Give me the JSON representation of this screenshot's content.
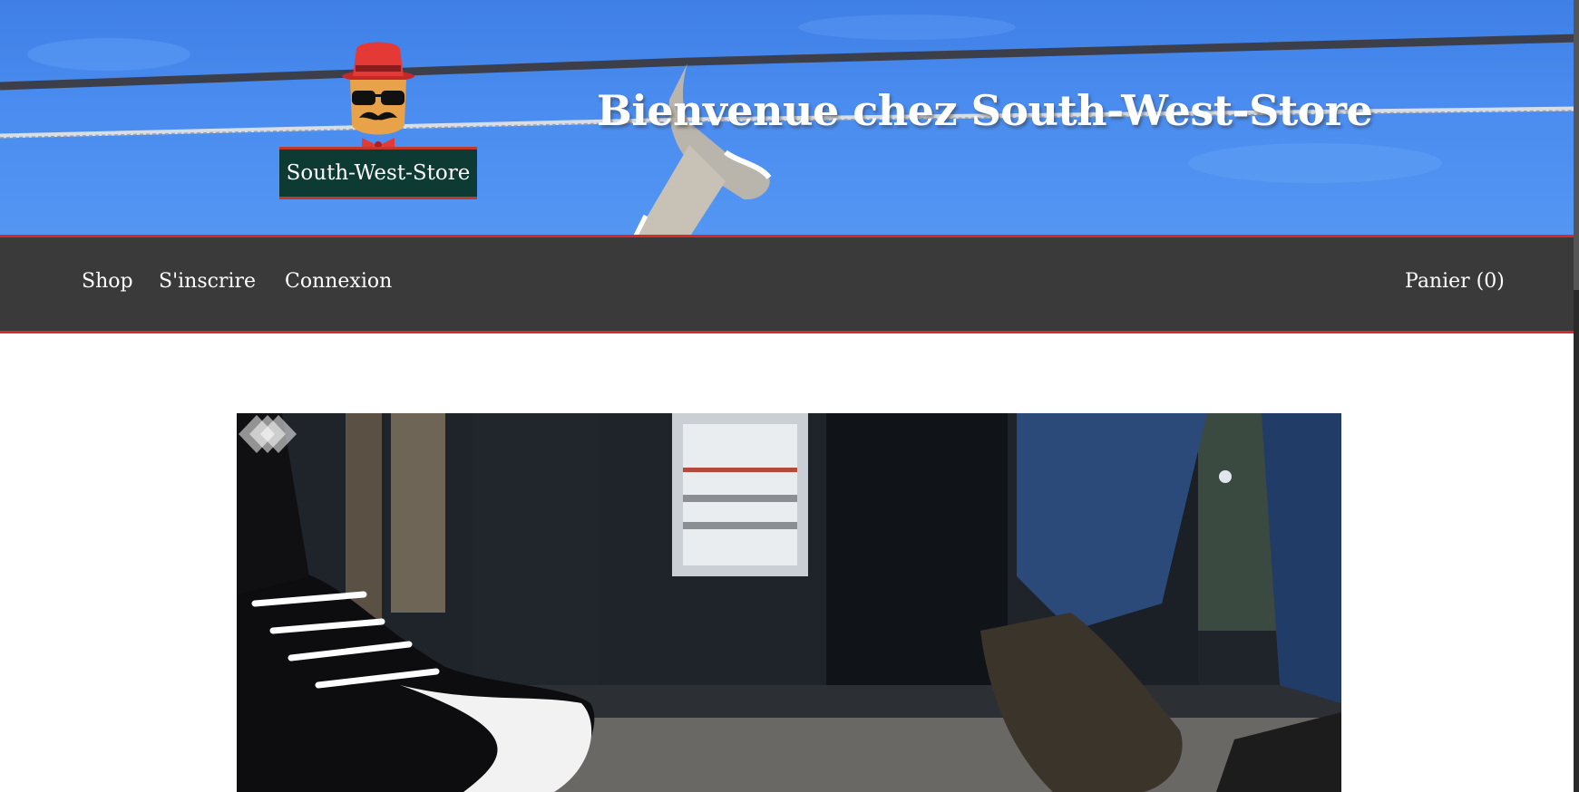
{
  "header": {
    "welcome_text": "Bienvenue chez South-West-Store",
    "logo_text": "South-West-Store",
    "logo_icon": "mustache-man-icon"
  },
  "nav": {
    "items": [
      {
        "label": "Shop"
      },
      {
        "label": "S'inscrire"
      },
      {
        "label": "Connexion"
      }
    ],
    "cart_label": "Panier (0)"
  },
  "hero": {
    "badge_icon": "diamonds-logo-icon"
  },
  "colors": {
    "banner_sky": "#4a8cf0",
    "nav_bg": "#3a3a3a",
    "accent_red": "#d42a2a",
    "logo_plate": "#0e3a34"
  }
}
